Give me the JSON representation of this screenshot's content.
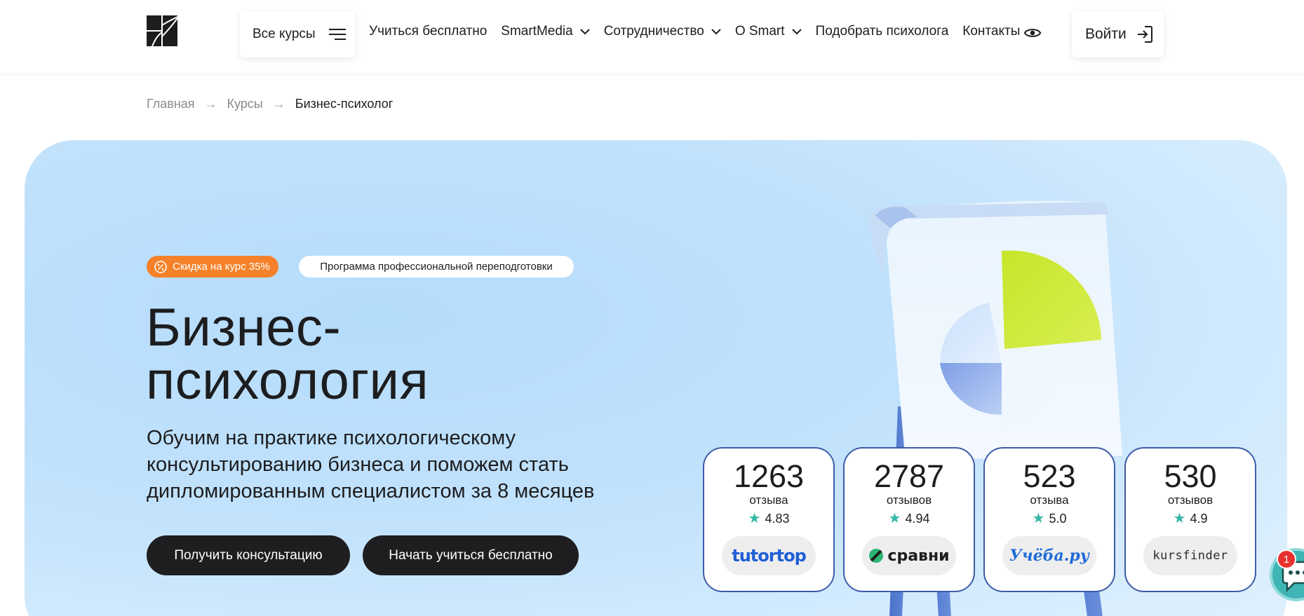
{
  "header": {
    "all_courses_label": "Все курсы",
    "nav": [
      {
        "label": "Учиться бесплатно",
        "dropdown": false
      },
      {
        "label": "SmartMedia",
        "dropdown": true
      },
      {
        "label": "Сотрудничество",
        "dropdown": true
      },
      {
        "label": "О Smart",
        "dropdown": true
      },
      {
        "label": "Подобрать психолога",
        "dropdown": false
      },
      {
        "label": "Контакты",
        "dropdown": false
      }
    ],
    "login_label": "Войти"
  },
  "breadcrumb": {
    "home": "Главная",
    "courses": "Курсы",
    "current": "Бизнес-психолог",
    "separator": "→"
  },
  "hero": {
    "discount_badge": "Скидка на курс 35%",
    "program_badge": "Программа профессиональной переподготовки",
    "title_line1": "Бизнес-",
    "title_line2": "психология",
    "subtitle": "Обучим на практике психологическому консультированию бизнеса и поможем стать дипломированным специалистом за 8 месяцев",
    "btn_consult": "Получить консультацию",
    "btn_start": "Начать учиться бесплатно"
  },
  "reviews": [
    {
      "count": "1263",
      "word": "отзыва",
      "rating": "4.83",
      "platform": "tutortop"
    },
    {
      "count": "2787",
      "word": "отзывов",
      "rating": "4.94",
      "platform": "сравни"
    },
    {
      "count": "523",
      "word": "отзыва",
      "rating": "5.0",
      "platform": "Учёба.ру"
    },
    {
      "count": "530",
      "word": "отзывов",
      "rating": "4.9",
      "platform": "kursfinder"
    }
  ],
  "chat": {
    "badge_count": "1"
  },
  "colors": {
    "accent_orange": "#f5822a",
    "dark_button": "#1e1e20",
    "card_border": "#3d5ca8",
    "star": "#37b8a7",
    "hero_bg": "#c2e2fc",
    "chat": "#3fb5b5",
    "chart_lime": "#cbe82c"
  }
}
